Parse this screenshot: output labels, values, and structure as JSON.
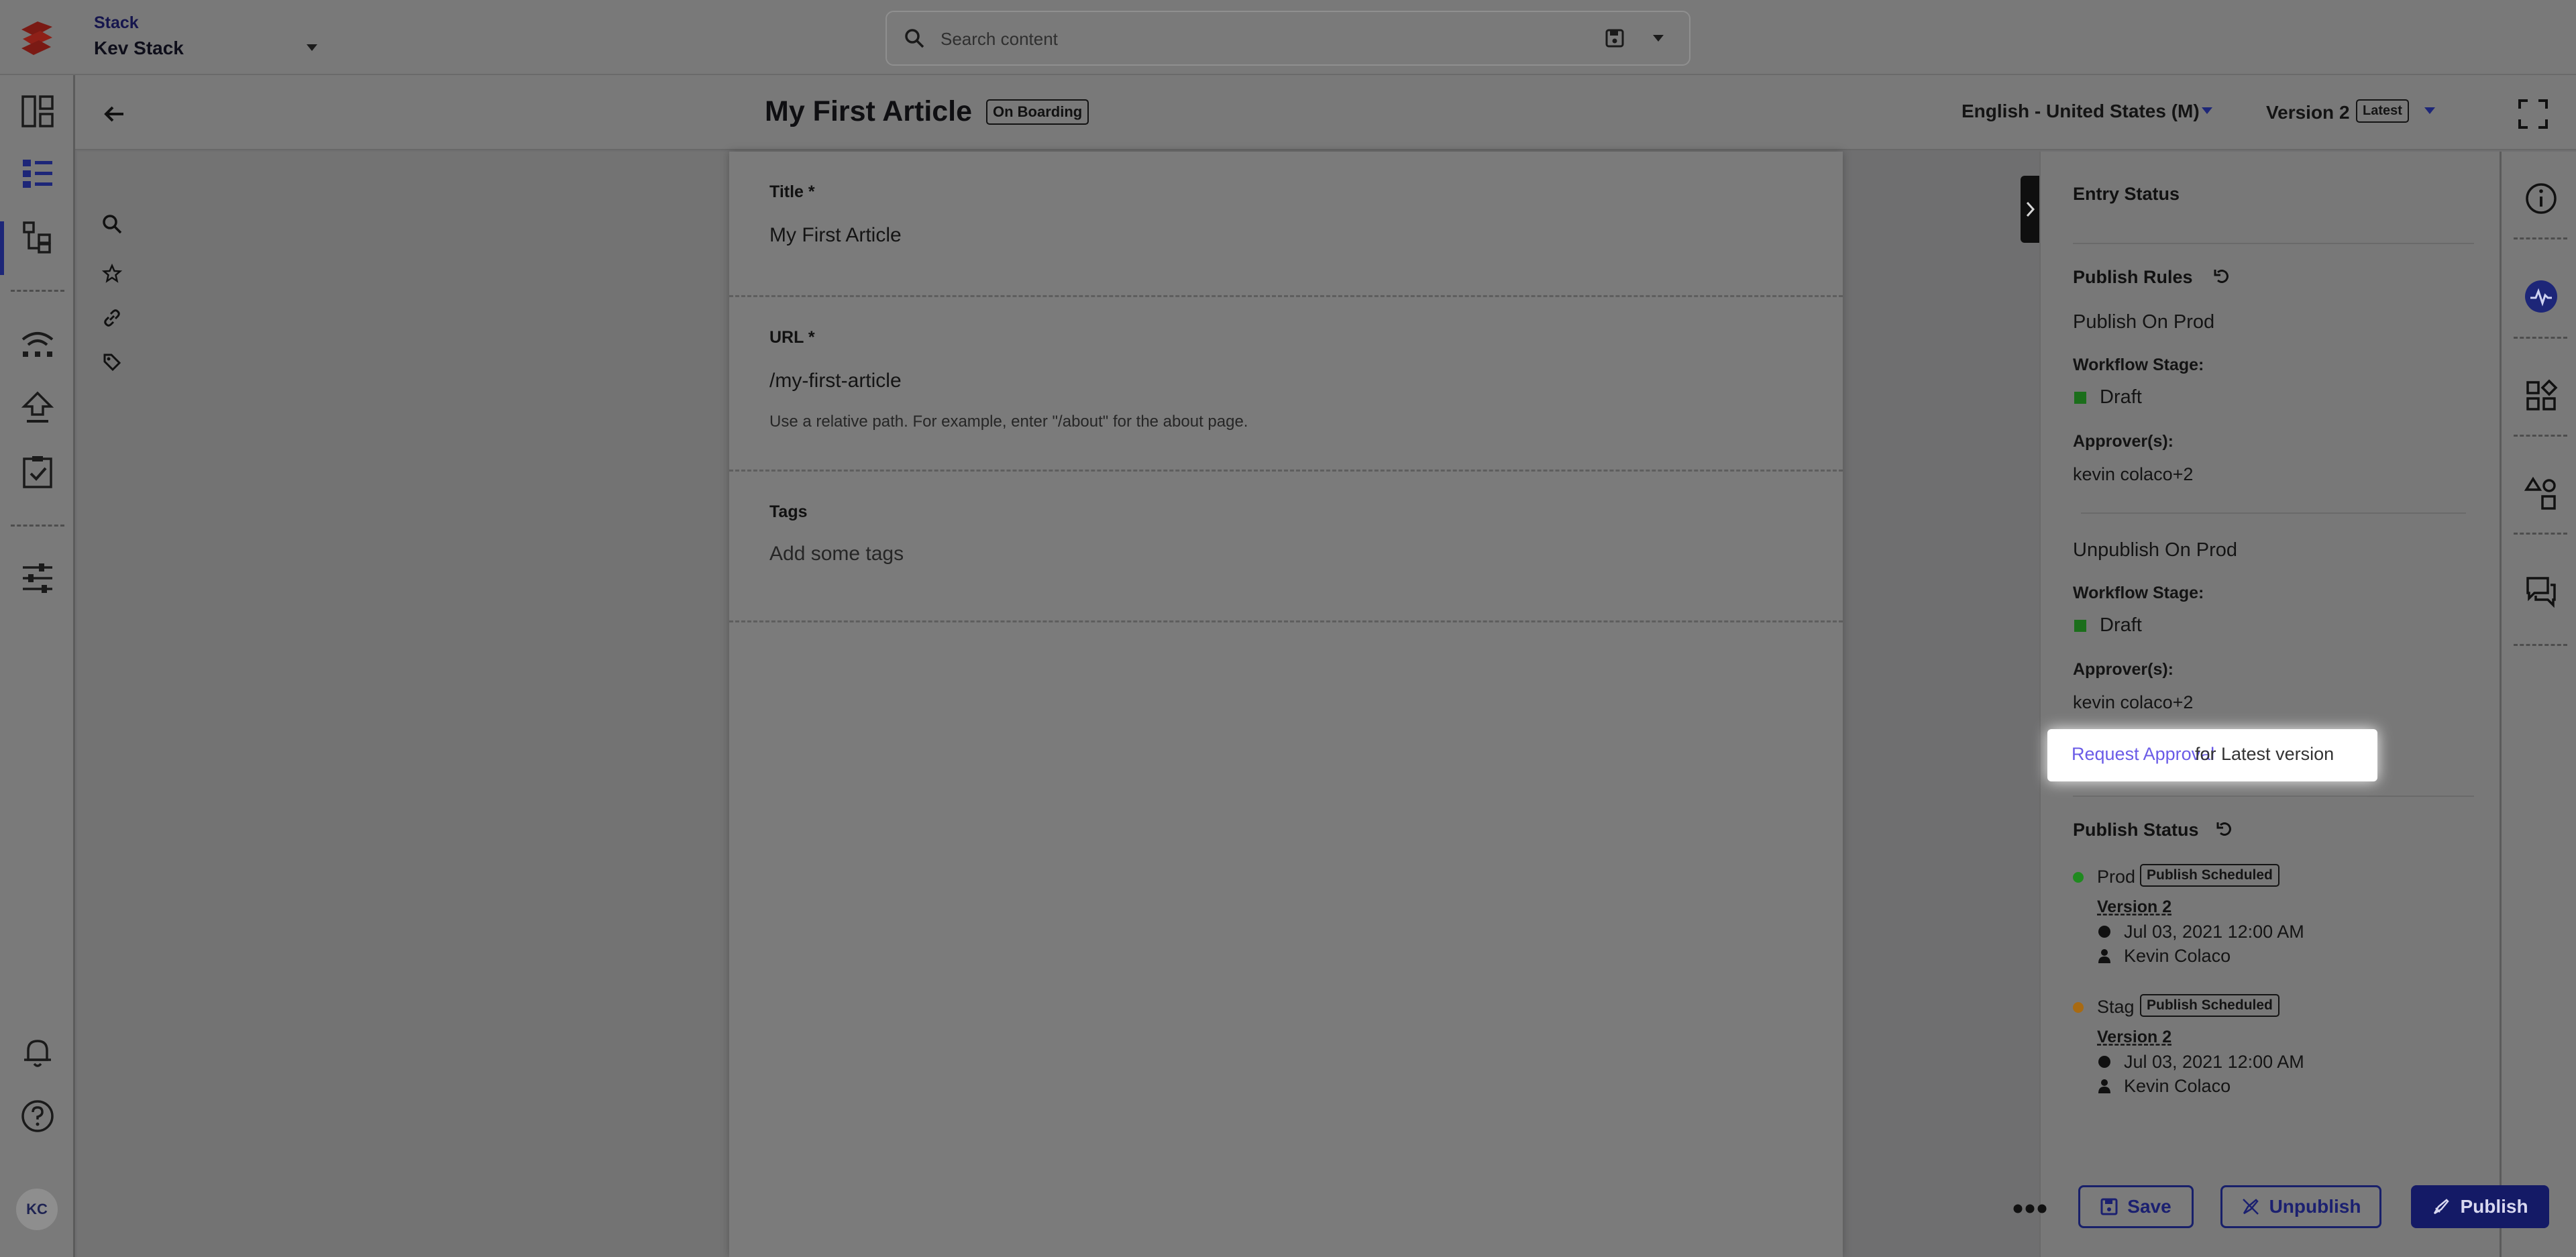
{
  "top_bar": {
    "stack_caption": "Stack",
    "stack_name": "Kev Stack",
    "search_placeholder": "Search content"
  },
  "user": {
    "initials": "KC"
  },
  "entry_header": {
    "title": "My First Article",
    "content_type_badge": "On Boarding",
    "locale": "English - United States (M)",
    "version_label": "Version 2",
    "version_badge": "Latest"
  },
  "fields": [
    {
      "label": "Title *",
      "value": "My First Article",
      "help": ""
    },
    {
      "label": "URL *",
      "value": "/my-first-article",
      "help": "Use a relative path. For example, enter \"/about\" for the about page."
    },
    {
      "label": "Tags",
      "value": "",
      "placeholder": "Add some tags",
      "help": ""
    }
  ],
  "entry_status": {
    "heading": "Entry Status",
    "publish_rules": {
      "heading": "Publish Rules",
      "rules": [
        {
          "name": "Publish On Prod",
          "stage_label": "Workflow Stage:",
          "stage": "Draft",
          "approvers_label": "Approver(s):",
          "approvers": "kevin colaco+2"
        },
        {
          "name": "Unpublish On Prod",
          "stage_label": "Workflow Stage:",
          "stage": "Draft",
          "approvers_label": "Approver(s):",
          "approvers": "kevin colaco+2"
        }
      ],
      "request_link": "Request Approval",
      "request_suffix": "for Latest version"
    },
    "publish_status": {
      "heading": "Publish Status",
      "environments": [
        {
          "name": "Prod",
          "badge": "Publish Scheduled",
          "version": "Version 2",
          "datetime": "Jul 03, 2021 12:00 AM",
          "user": "Kevin Colaco",
          "dot_color": "#1f8a1f"
        },
        {
          "name": "Stag",
          "badge": "Publish Scheduled",
          "version": "Version 2",
          "datetime": "Jul 03, 2021 12:00 AM",
          "user": "Kevin Colaco",
          "dot_color": "#a86a12"
        }
      ]
    }
  },
  "footer": {
    "save_label": "Save",
    "unpublish_label": "Unpublish",
    "publish_label": "Publish"
  },
  "colors": {
    "accent": "#1d2678",
    "link": "#6b5ce7",
    "stage_draft": "#1b6e1b"
  }
}
